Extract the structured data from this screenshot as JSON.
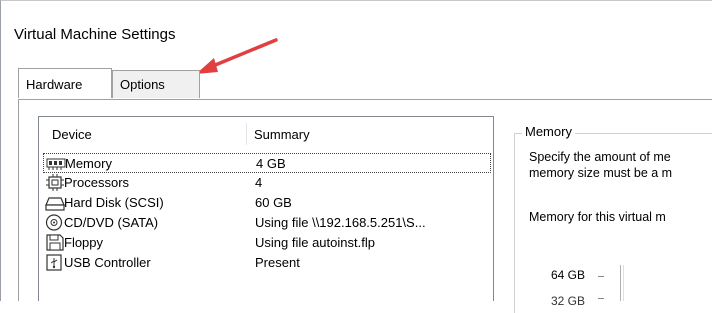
{
  "window": {
    "title": "Virtual Machine Settings"
  },
  "tabs": [
    {
      "label": "Hardware",
      "active": true
    },
    {
      "label": "Options",
      "active": false
    }
  ],
  "device_list": {
    "columns": {
      "device": "Device",
      "summary": "Summary"
    },
    "rows": [
      {
        "icon": "memory-icon",
        "name": "Memory",
        "summary": "4 GB",
        "selected": true
      },
      {
        "icon": "processor-icon",
        "name": "Processors",
        "summary": "4",
        "selected": false
      },
      {
        "icon": "hard-disk-icon",
        "name": "Hard Disk (SCSI)",
        "summary": "60 GB",
        "selected": false
      },
      {
        "icon": "cd-dvd-icon",
        "name": "CD/DVD (SATA)",
        "summary": "Using file \\\\192.168.5.251\\S...",
        "selected": false
      },
      {
        "icon": "floppy-icon",
        "name": "Floppy",
        "summary": "Using file autoinst.flp",
        "selected": false
      },
      {
        "icon": "usb-icon",
        "name": "USB Controller",
        "summary": "Present",
        "selected": false
      }
    ]
  },
  "memory_panel": {
    "legend": "Memory",
    "description_line1": "Specify the amount of me",
    "description_line2": "memory size must be a m",
    "memory_for_label": "Memory for this virtual m",
    "scale_top": "64 GB",
    "scale_next": "32 GB"
  },
  "annotation": {
    "arrow_color": "#e04040"
  }
}
